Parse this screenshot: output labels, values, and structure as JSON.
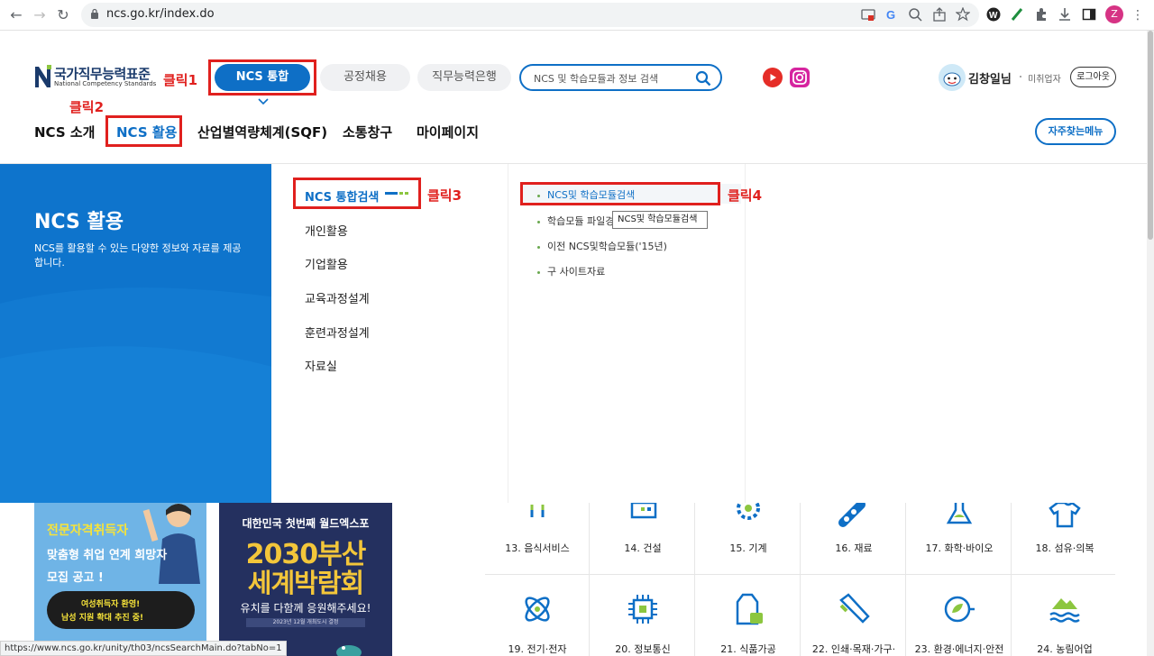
{
  "browser": {
    "url": "ncs.go.kr/index.do",
    "profile_initial": "Z"
  },
  "header": {
    "logo_kr": "국가직무능력표준",
    "logo_en": "National Competency Standards",
    "pills": {
      "ncs": "NCS 통합",
      "hire": "공정채용",
      "bank": "직무능력은행"
    },
    "search_placeholder": "NCS 및 학습모듈과 정보 검색",
    "user_name": "김창일님",
    "user_type": "미취업자",
    "logout": "로그아웃",
    "faq_menu": "자주찾는메뉴"
  },
  "gnb": {
    "items": [
      "NCS 소개",
      "NCS 활용",
      "산업별역량체계(SQF)",
      "소통창구",
      "마이페이지"
    ]
  },
  "annotations": {
    "click1": "클릭1",
    "click2": "클릭2",
    "click3": "클릭3",
    "click4": "클릭4"
  },
  "mega": {
    "title": "NCS 활용",
    "desc": "NCS를 활용할 수 있는 다양한 정보와 자료를 제공합니다.",
    "mid_items": [
      "NCS 통합검색",
      "개인활용",
      "기업활용",
      "교육과정설계",
      "훈련과정설계",
      "자료실"
    ],
    "sub_items": [
      "NCS및 학습모듈검색",
      "학습모듈 파일경",
      "이전 NCS및학습모듈('15년)",
      "구 사이트자료"
    ],
    "tooltip": "NCS및 학습모듈검색"
  },
  "banners": {
    "b1": {
      "line1": "전문자격취득자",
      "line2": "맞춤형 취업 연계 희망자",
      "line3": "모집 공고 !",
      "bubble1": "여성취득자 환영!",
      "bubble2": "남성 지원 확대 추진 중!"
    },
    "b2": {
      "line1": "대한민국 첫번째 월드엑스포",
      "line2": "2030부산",
      "line3": "세계박람회",
      "line4": "유치를 다함께 응원해주세요!",
      "line5": "2023년 12월 개최도시 결정"
    }
  },
  "grid": {
    "row1": [
      "13. 음식서비스",
      "14. 건설",
      "15. 기계",
      "16. 재료",
      "17. 화학·바이오",
      "18. 섬유·의복"
    ],
    "row2": [
      "19. 전기·전자",
      "20. 정보통신",
      "21. 식품가공",
      "22. 인쇄·목재·가구·",
      "23. 환경·에너지·안전",
      "24. 농림어업"
    ]
  },
  "statusbar": "https://www.ncs.go.kr/unity/th03/ncsSearchMain.do?tabNo=1",
  "colors": {
    "brand_blue": "#0e6fc6",
    "annotation_red": "#e0201e",
    "icon_accent": "#8cc63f"
  }
}
